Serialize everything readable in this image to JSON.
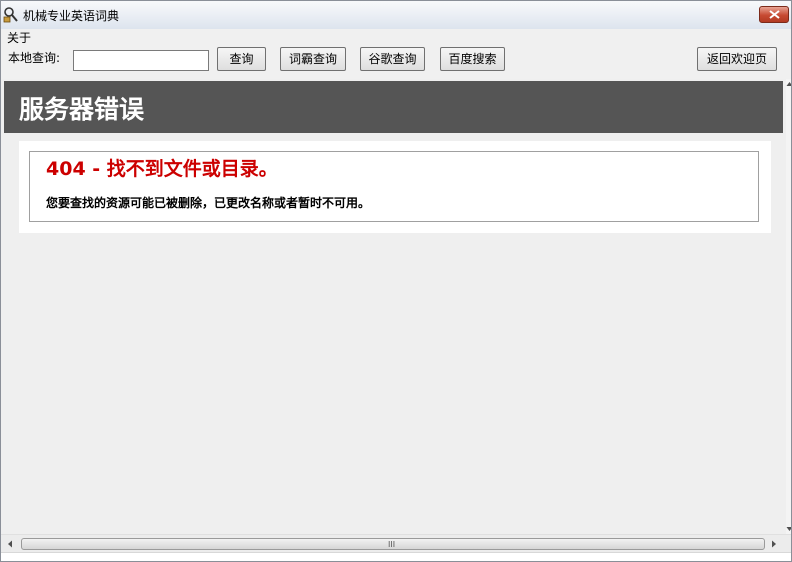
{
  "window": {
    "title": "机械专业英语词典"
  },
  "menu": {
    "items": [
      "关于"
    ]
  },
  "toolbar": {
    "local_label": "本地查询:",
    "search_value": "",
    "query_button": "查询",
    "ciba_button": "词霸查询",
    "google_button": "谷歌查询",
    "baidu_button": "百度搜索",
    "back_button": "返回欢迎页"
  },
  "page": {
    "header": "服务器错误",
    "error_title": "404 - 找不到文件或目录。",
    "error_desc": "您要查找的资源可能已被删除，已更改名称或者暂时不可用。"
  },
  "scrollbar": {
    "grip": "III"
  },
  "colors": {
    "header_bg": "#555555",
    "error_red": "#cc0000"
  }
}
